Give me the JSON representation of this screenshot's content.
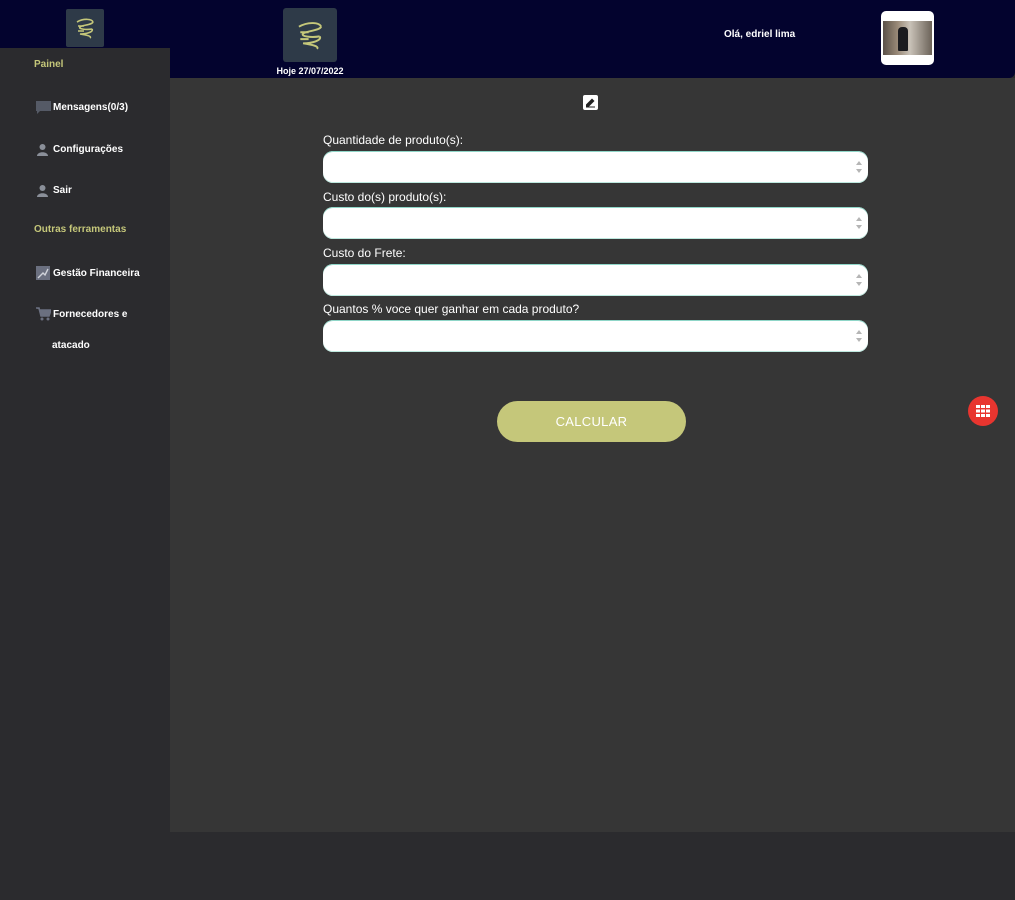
{
  "header": {
    "date_text": "Hoje 27/07/2022",
    "greeting": "Olá, edriel lima"
  },
  "sidebar": {
    "heading_panel": "Painel",
    "items": [
      {
        "label": "Mensagens(0/3)",
        "icon": "chat-icon"
      },
      {
        "label": "Configurações",
        "icon": "user-icon"
      },
      {
        "label": "Sair",
        "icon": "user-icon"
      }
    ],
    "heading_tools": "Outras ferramentas",
    "tools": [
      {
        "label": "Gestão Financeira",
        "icon": "chart-icon"
      },
      {
        "label_line1": "Fornecedores e",
        "label_line2": "atacado",
        "icon": "cart-icon"
      }
    ]
  },
  "form": {
    "fields": [
      {
        "label": "Quantidade de produto(s):",
        "value": ""
      },
      {
        "label": "Custo do(s) produto(s):",
        "value": ""
      },
      {
        "label": "Custo do Frete:",
        "value": ""
      },
      {
        "label": "Quantos % voce quer ganhar em cada produto?",
        "value": ""
      }
    ],
    "submit_label": "CALCULAR"
  },
  "colors": {
    "header_bg": "#03032e",
    "accent": "#c5c77a",
    "content_bg": "#363636",
    "sidebar_bg": "#2b2b2e",
    "fab": "#e8352f"
  }
}
